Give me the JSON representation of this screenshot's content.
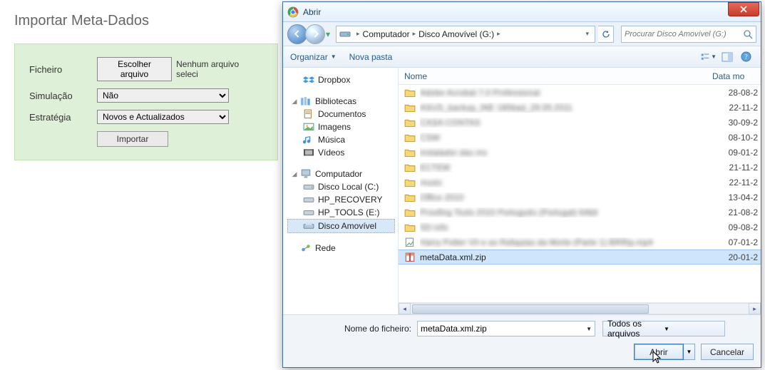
{
  "bg": {
    "title": "Importar Meta-Dados",
    "file_label": "Ficheiro",
    "choose_file": "Escolher arquivo",
    "file_status": "Nenhum arquivo seleci",
    "sim_label": "Simulação",
    "sim_value": "Não",
    "strategy_label": "Estratégia",
    "strategy_value": "Novos e Actualizados",
    "import_btn": "Importar"
  },
  "dlg": {
    "title": "Abrir",
    "breadcrumb": {
      "root": "Computador",
      "leaf": "Disco Amovível (G:)"
    },
    "search_placeholder": "Procurar Disco Amovível (G:)",
    "toolbar": {
      "organize": "Organizar",
      "new_folder": "Nova pasta"
    },
    "tree": {
      "dropbox": "Dropbox",
      "libraries": "Bibliotecas",
      "lib_docs": "Documentos",
      "lib_images": "Imagens",
      "lib_music": "Música",
      "lib_videos": "Vídeos",
      "computer": "Computador",
      "disk_local": "Disco Local (C:)",
      "hp_recovery": "HP_RECOVERY",
      "hp_tools": "HP_TOOLS (E:)",
      "disk_removable": "Disco Amovível",
      "network": "Rede"
    },
    "columns": {
      "name": "Nome",
      "date": "Data mo"
    },
    "rows": [
      {
        "type": "folder",
        "name": "Adobe Acrobat 7.0 Professional",
        "date": "28-08-2"
      },
      {
        "type": "folder",
        "name": "ASUS_backup_INE 180bad_26.05.2011",
        "date": "22-11-2"
      },
      {
        "type": "folder",
        "name": "CASA CONTAS",
        "date": "30-09-2"
      },
      {
        "type": "folder",
        "name": "CSW",
        "date": "08-10-2"
      },
      {
        "type": "folder",
        "name": "instalador das ms",
        "date": "09-01-2"
      },
      {
        "type": "folder",
        "name": "ECTEM",
        "date": "21-11-2"
      },
      {
        "type": "folder",
        "name": "music",
        "date": "22-11-2"
      },
      {
        "type": "folder",
        "name": "Office 2010",
        "date": "13-04-2"
      },
      {
        "type": "folder",
        "name": "Proofing Tools 2010 Português (Portugal) 64bit",
        "date": "21-08-2"
      },
      {
        "type": "folder",
        "name": "SD info",
        "date": "09-08-2"
      },
      {
        "type": "file",
        "name": "Harry Potter VII e as Reliquias da Morte (Parte 1) BRRip.mp4",
        "date": "07-01-2"
      },
      {
        "type": "zip",
        "name": "metaData.xml.zip",
        "date": "20-01-2",
        "selected": true
      }
    ],
    "filename_label": "Nome do ficheiro:",
    "filename_value": "metaData.xml.zip",
    "filetype": "Todos os arquivos",
    "open_btn": "Abrir",
    "cancel_btn": "Cancelar"
  }
}
